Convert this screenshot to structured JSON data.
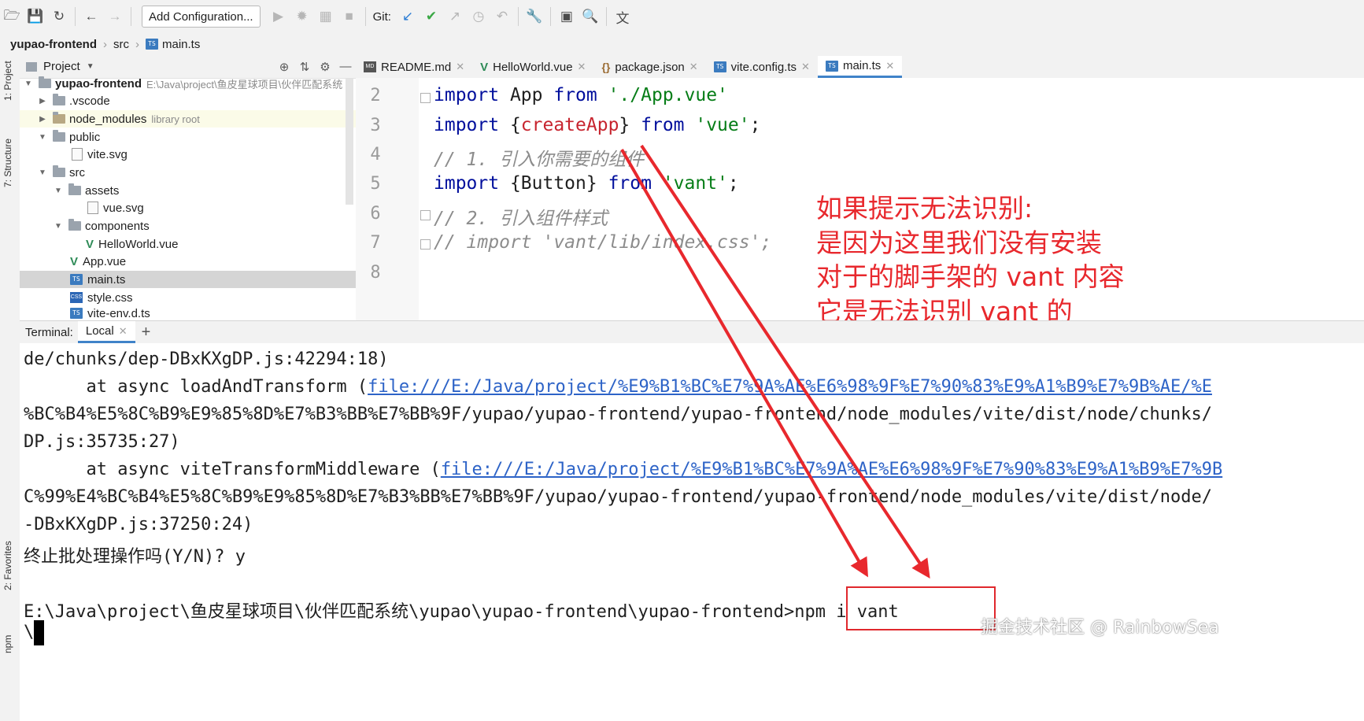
{
  "toolbar": {
    "add_config_label": "Add Configuration...",
    "git_label": "Git:"
  },
  "breadcrumb": [
    "yupao-frontend",
    "src",
    "main.ts"
  ],
  "left_strip": {
    "project": "1: Project",
    "structure": "7: Structure",
    "favorites": "2: Favorites",
    "npm": "npm"
  },
  "project_panel": {
    "title": "Project",
    "tree": [
      {
        "label": "yupao-frontend",
        "hint": "E:\\Java\\project\\鱼皮星球项目\\伙伴匹配系统"
      },
      {
        "label": ".vscode"
      },
      {
        "label": "node_modules",
        "hint": "library root"
      },
      {
        "label": "public"
      },
      {
        "label": "vite.svg"
      },
      {
        "label": "src"
      },
      {
        "label": "assets"
      },
      {
        "label": "vue.svg"
      },
      {
        "label": "components"
      },
      {
        "label": "HelloWorld.vue"
      },
      {
        "label": "App.vue"
      },
      {
        "label": "main.ts"
      },
      {
        "label": "style.css"
      },
      {
        "label": "vite-env.d.ts"
      }
    ]
  },
  "editor": {
    "tabs": [
      {
        "label": "README.md",
        "icon": "MD"
      },
      {
        "label": "HelloWorld.vue",
        "icon": "V"
      },
      {
        "label": "package.json",
        "icon": "{}"
      },
      {
        "label": "vite.config.ts",
        "icon": "TS"
      },
      {
        "label": "main.ts",
        "icon": "TS"
      }
    ],
    "line_numbers": [
      "2",
      "3",
      "4",
      "5",
      "6",
      "7",
      "8"
    ],
    "code": {
      "l2_import": "import",
      "l2_app": " App ",
      "l2_from": "from",
      "l2_str": " './App.vue'",
      "l3_import": "import",
      "l3_open": " {",
      "l3_fn": "createApp",
      "l3_close": "} ",
      "l3_from": "from",
      "l3_str": " 'vue'",
      "l3_semi": ";",
      "l4_comment": "// 1. 引入你需要的组件",
      "l5_import": "import",
      "l5_btn": " {Button} ",
      "l5_from": "from",
      "l5_str": " 'vant'",
      "l5_semi": ";",
      "l6_comment": "// 2. 引入组件样式",
      "l7_comment": "// import 'vant/lib/index.css';"
    }
  },
  "annotation": [
    "如果提示无法识别:",
    "是因为这里我们没有安装",
    "对于的脚手架的 vant 内容",
    "它是无法识别 vant 的"
  ],
  "terminal": {
    "label": "Terminal:",
    "tab": "Local",
    "lines": {
      "l1": "de/chunks/dep-DBxKXgDP.js:42294:18)",
      "l2_pre": "      at async loadAndTransform (",
      "l2_link": "file:///E:/Java/project/%E9%B1%BC%E7%9A%AE%E6%98%9F%E7%90%83%E9%A1%B9%E7%9B%AE/%E",
      "l3": "%BC%B4%E5%8C%B9%E9%85%8D%E7%B3%BB%E7%BB%9F/yupao/yupao-frontend/yupao-frontend/node_modules/vite/dist/node/chunks/",
      "l4": "DP.js:35735:27)",
      "l5_pre": "      at async viteTransformMiddleware (",
      "l5_link": "file:///E:/Java/project/%E9%B1%BC%E7%9A%AE%E6%98%9F%E7%90%83%E9%A1%B9%E7%9B",
      "l6": "C%99%E4%BC%B4%E5%8C%B9%E9%85%8D%E7%B3%BB%E7%BB%9F/yupao/yupao-frontend/yupao-frontend/node_modules/vite/dist/node/",
      "l7": "-DBxKXgDP.js:37250:24)",
      "l8": "终止批处理操作吗(Y/N)? y",
      "l9_path": "E:\\Java\\project\\鱼皮星球项目\\伙伴匹配系统\\yupao\\yupao-frontend\\yupao-frontend>",
      "l9_cmd": "npm i vant",
      "l10": "\\"
    }
  },
  "watermark": "掘金技术社区 @ RainbowSea",
  "colors": {
    "annotation": "#e8282d",
    "link": "#2d63c7",
    "keyword": "#000e9c",
    "string": "#067d17"
  }
}
